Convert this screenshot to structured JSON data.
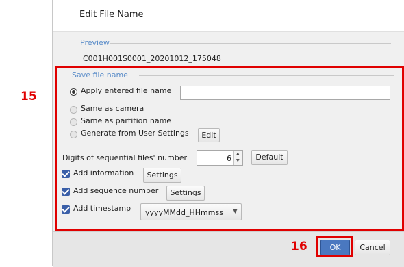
{
  "dialog": {
    "title": "Edit File Name"
  },
  "preview": {
    "legend": "Preview",
    "value": "C001H001S0001_20201012_175048"
  },
  "save_file_name": {
    "legend": "Save file name",
    "options": [
      {
        "label": "Apply entered file name",
        "selected": true
      },
      {
        "label": "Same as camera",
        "selected": false
      },
      {
        "label": "Same as partition name",
        "selected": false
      },
      {
        "label": "Generate from User Settings",
        "selected": false
      }
    ],
    "file_name_value": "",
    "edit_button": "Edit"
  },
  "digits": {
    "label": "Digits of sequential files' number",
    "value": "6",
    "default_button": "Default"
  },
  "add_information": {
    "label": "Add information",
    "checked": true,
    "button": "Settings"
  },
  "add_sequence": {
    "label": "Add sequence number",
    "checked": true,
    "button": "Settings"
  },
  "add_timestamp": {
    "label": "Add timestamp",
    "checked": true,
    "format": "yyyyMMdd_HHmmss"
  },
  "annotations": {
    "box": "15",
    "ok": "16"
  },
  "footer": {
    "ok_button": "OK",
    "cancel_button": "Cancel"
  },
  "colors": {
    "accent_red": "#e00000",
    "checkbox_blue": "#3a5fa8",
    "legend_blue": "#5b8dc9",
    "ok_blue": "#4a78c0"
  }
}
